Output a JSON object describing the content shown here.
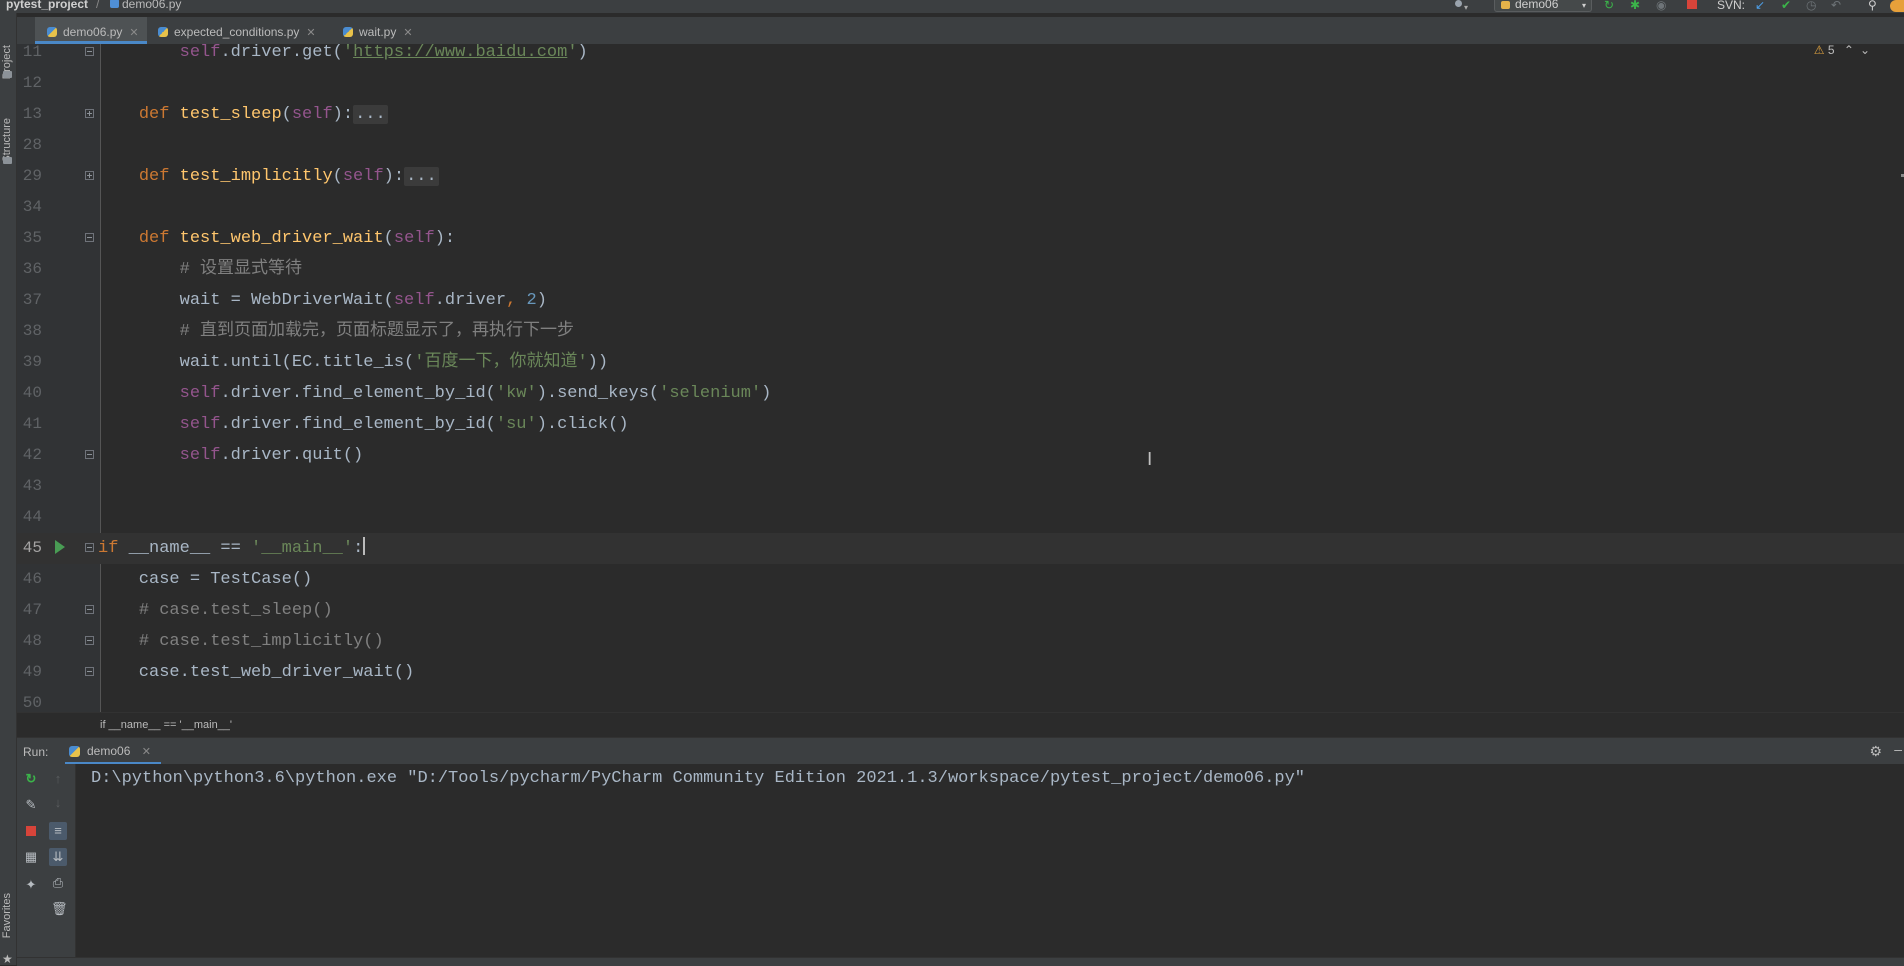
{
  "breadcrumb": {
    "project": "pytest_project",
    "separator": "/",
    "file": "demo06.py"
  },
  "toolbar": {
    "run_config": "demo06",
    "svn_label": "SVN:"
  },
  "left_strip": {
    "project": "Project",
    "structure": "Structure",
    "favorites": "Favorites"
  },
  "tabs": [
    {
      "label": "demo06.py",
      "active": true
    },
    {
      "label": "expected_conditions.py",
      "active": false
    },
    {
      "label": "wait.py",
      "active": false
    }
  ],
  "inspection": {
    "warnings": "5"
  },
  "editor_lines": [
    {
      "num": "11",
      "code": "        self.driver.get('https://www.baidu.com')"
    },
    {
      "num": "12",
      "code": ""
    },
    {
      "num": "13",
      "code": "    def test_sleep(self):..."
    },
    {
      "num": "28",
      "code": ""
    },
    {
      "num": "29",
      "code": "    def test_implicitly(self):..."
    },
    {
      "num": "34",
      "code": ""
    },
    {
      "num": "35",
      "code": "    def test_web_driver_wait(self):"
    },
    {
      "num": "36",
      "code": "        # 设置显式等待"
    },
    {
      "num": "37",
      "code": "        wait = WebDriverWait(self.driver, 2)"
    },
    {
      "num": "38",
      "code": "        # 直到页面加载完，页面标题显示了，再执行下一步"
    },
    {
      "num": "39",
      "code": "        wait.until(EC.title_is('百度一下，你就知道'))"
    },
    {
      "num": "40",
      "code": "        self.driver.find_element_by_id('kw').send_keys('selenium')"
    },
    {
      "num": "41",
      "code": "        self.driver.find_element_by_id('su').click()"
    },
    {
      "num": "42",
      "code": "        self.driver.quit()"
    },
    {
      "num": "43",
      "code": ""
    },
    {
      "num": "44",
      "code": ""
    },
    {
      "num": "45",
      "code": "if __name__ == '__main__':"
    },
    {
      "num": "46",
      "code": "    case = TestCase()"
    },
    {
      "num": "47",
      "code": "    # case.test_sleep()"
    },
    {
      "num": "48",
      "code": "    # case.test_implicitly()"
    },
    {
      "num": "49",
      "code": "    case.test_web_driver_wait()"
    },
    {
      "num": "50",
      "code": ""
    }
  ],
  "code_breadcrumb": "if __name__ == '__main__'",
  "run_panel": {
    "label": "Run:",
    "tab": "demo06",
    "console_output": "D:\\python\\python3.6\\python.exe \"D:/Tools/pycharm/PyCharm Community Edition 2021.1.3/workspace/pytest_project/demo06.py\""
  },
  "icons": [
    "user-icon",
    "run-config-icon",
    "rerun-icon",
    "debug-icon",
    "coverage-icon",
    "profile-icon",
    "stop-icon",
    "svn-update-icon",
    "svn-commit-icon",
    "svn-history-icon",
    "svn-revert-icon",
    "search-icon",
    "run-gutter-icon",
    "fold-icon",
    "gear-icon",
    "minimize-icon",
    "wrench-icon",
    "layout-icon",
    "pin-icon",
    "arrow-up-icon",
    "arrow-down-icon",
    "soft-wrap-icon",
    "scroll-to-end-icon",
    "print-icon",
    "trash-icon",
    "star-icon"
  ],
  "colors": {
    "editor_bg": "#2b2b2b",
    "keyword": "#cc7832",
    "function": "#ffc66d",
    "self": "#94558d",
    "string": "#6a8759",
    "number": "#6897bb",
    "comment": "#808080",
    "accent": "#4a88c7"
  }
}
